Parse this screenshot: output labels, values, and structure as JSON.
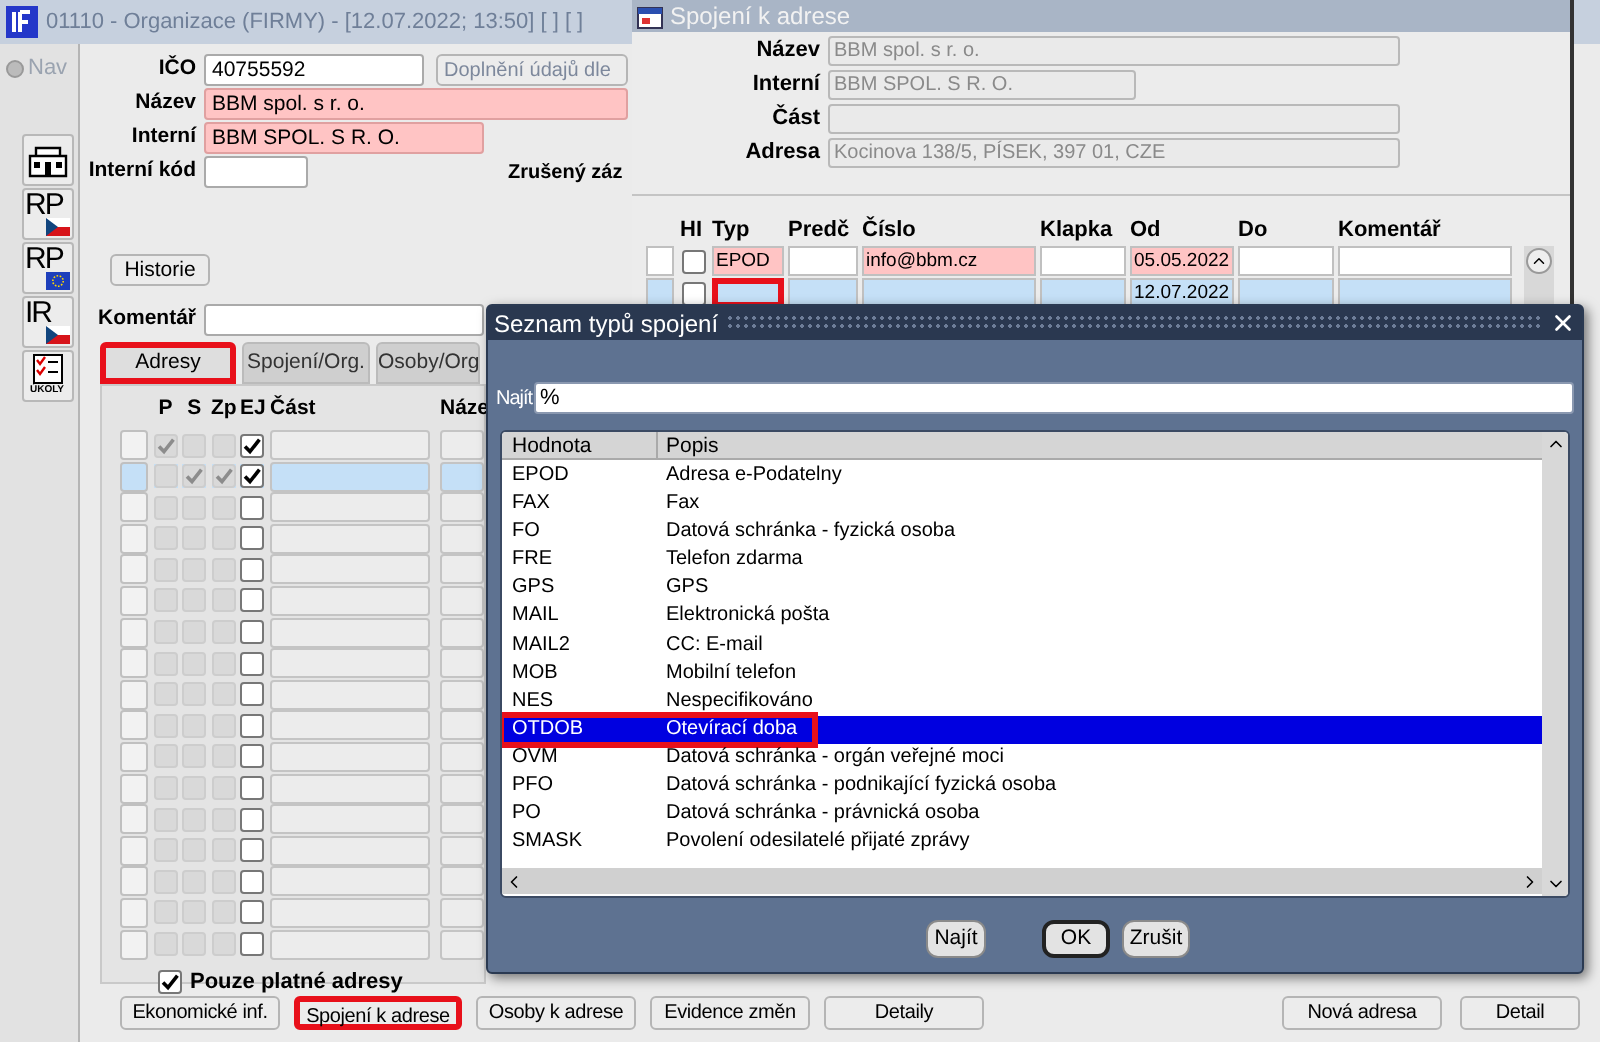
{
  "main_window": {
    "title": "01110 - Organizace (FIRMY) - [12.07.2022; 13:50] [ ] [ ]",
    "nav": {
      "label": "Nav",
      "buttons": [
        {
          "kind": "building"
        },
        {
          "kind": "czflag",
          "label": "RP"
        },
        {
          "kind": "euflag",
          "label": "RP"
        },
        {
          "kind": "czflag",
          "label": "IR"
        },
        {
          "kind": "tasks",
          "label": "ÚKOLY"
        }
      ]
    },
    "fields": [
      {
        "label": "IČO",
        "value": "40755592",
        "required": false
      },
      {
        "label": "Název",
        "value": "BBM spol. s r. o.",
        "required": true
      },
      {
        "label": "Interní",
        "value": "BBM SPOL. S R. O.",
        "required": true
      },
      {
        "label": "Interní kód",
        "required": false
      }
    ],
    "supplement_button": "Doplnění údajů dle",
    "cancelled_label": "Zrušený záz",
    "history_button": "Historie",
    "comment_label": "Komentář",
    "tabs": [
      {
        "label": "Adresy",
        "selected": true,
        "highlighted": true
      },
      {
        "label": "Spojení/Org.",
        "selected": false,
        "highlighted": false
      },
      {
        "label": "Osoby/Org",
        "selected": false,
        "highlighted": false
      }
    ],
    "address_grid": {
      "columns": [
        {
          "label": "P",
          "kind": "check",
          "disabled": true
        },
        {
          "label": "S",
          "kind": "check",
          "disabled": true
        },
        {
          "label": "Zp",
          "kind": "check",
          "disabled": true
        },
        {
          "label": "EJ",
          "kind": "check",
          "disabled": false
        },
        {
          "label": "Část",
          "kind": "text"
        },
        {
          "label": "Náze",
          "kind": "text"
        }
      ],
      "rows": [
        {
          "selected": false,
          "checks": [
            true,
            false,
            false,
            true
          ]
        },
        {
          "selected": true,
          "checks": [
            false,
            true,
            true,
            true
          ]
        },
        {
          "selected": false,
          "checks": [
            false,
            false,
            false,
            false
          ]
        },
        {
          "selected": false,
          "checks": [
            false,
            false,
            false,
            false
          ]
        },
        {
          "selected": false,
          "checks": [
            false,
            false,
            false,
            false
          ]
        },
        {
          "selected": false,
          "checks": [
            false,
            false,
            false,
            false
          ]
        },
        {
          "selected": false,
          "checks": [
            false,
            false,
            false,
            false
          ]
        },
        {
          "selected": false,
          "checks": [
            false,
            false,
            false,
            false
          ]
        },
        {
          "selected": false,
          "checks": [
            false,
            false,
            false,
            false
          ]
        },
        {
          "selected": false,
          "checks": [
            false,
            false,
            false,
            false
          ]
        },
        {
          "selected": false,
          "checks": [
            false,
            false,
            false,
            false
          ]
        },
        {
          "selected": false,
          "checks": [
            false,
            false,
            false,
            false
          ]
        },
        {
          "selected": false,
          "checks": [
            false,
            false,
            false,
            false
          ]
        },
        {
          "selected": false,
          "checks": [
            false,
            false,
            false,
            false
          ]
        },
        {
          "selected": false,
          "checks": [
            false,
            false,
            false,
            false
          ]
        },
        {
          "selected": false,
          "checks": [
            false,
            false,
            false,
            false
          ]
        },
        {
          "selected": false,
          "checks": [
            false,
            false,
            false,
            false
          ]
        }
      ]
    },
    "valid_only": {
      "label": "Pouze platné adresy",
      "checked": true
    },
    "buttons_left": [
      {
        "label": "Ekonomické inf.",
        "highlighted": false
      },
      {
        "label": "Spojení k adrese",
        "highlighted": true
      },
      {
        "label": "Osoby k adrese",
        "highlighted": false
      },
      {
        "label": "Evidence změn",
        "highlighted": false
      },
      {
        "label": "Detaily",
        "highlighted": false
      }
    ],
    "buttons_right": [
      {
        "label": "Nová adresa",
        "highlighted": false
      },
      {
        "label": "Detail",
        "highlighted": false
      }
    ]
  },
  "connection_window": {
    "title": "Spojení k adrese",
    "fields": [
      {
        "label": "Název",
        "value": "BBM spol. s r. o."
      },
      {
        "label": "Interní",
        "value": "BBM SPOL. S R. O."
      },
      {
        "label": "Část"
      },
      {
        "label": "Adresa",
        "value": "Kocinova 138/5, PÍSEK, 397 01, CZE"
      }
    ],
    "grid": {
      "check_column": "HI",
      "columns": [
        {
          "label": "Typ",
          "required": true
        },
        {
          "label": "Predč",
          "required": false
        },
        {
          "label": "Číslo",
          "required": true
        },
        {
          "label": "Klapka",
          "required": false
        },
        {
          "label": "Od",
          "required": true
        },
        {
          "label": "Do",
          "required": false
        },
        {
          "label": "Komentář",
          "required": false
        }
      ],
      "rows": [
        {
          "selected": false,
          "hi": false,
          "cells": [
            "EPOD",
            null,
            "info@bbm.cz",
            null,
            "05.05.2022",
            null,
            null
          ],
          "highlights": [
            false,
            false,
            false,
            false,
            false,
            false,
            false
          ]
        },
        {
          "selected": true,
          "hi": false,
          "cells": [
            null,
            null,
            null,
            null,
            "12.07.2022",
            null,
            null
          ],
          "highlights": [
            true,
            false,
            false,
            false,
            false,
            false,
            false
          ]
        }
      ]
    }
  },
  "lov_dialog": {
    "title": "Seznam typů spojení",
    "find_label": "Najít",
    "find_value": "%",
    "columns": [
      "Hodnota",
      "Popis"
    ],
    "rows": [
      {
        "value": "EPOD",
        "description": "Adresa e-Podatelny",
        "selected": false,
        "highlighted": false
      },
      {
        "value": "FAX",
        "description": "Fax",
        "selected": false,
        "highlighted": false
      },
      {
        "value": "FO",
        "description": "Datová schránka - fyzická osoba",
        "selected": false,
        "highlighted": false
      },
      {
        "value": "FRE",
        "description": "Telefon zdarma",
        "selected": false,
        "highlighted": false
      },
      {
        "value": "GPS",
        "description": "GPS",
        "selected": false,
        "highlighted": false
      },
      {
        "value": "MAIL",
        "description": "Elektronická pošta",
        "selected": false,
        "highlighted": false
      },
      {
        "value": "MAIL2",
        "description": "CC: E-mail",
        "selected": false,
        "highlighted": false
      },
      {
        "value": "MOB",
        "description": "Mobilní telefon",
        "selected": false,
        "highlighted": false
      },
      {
        "value": "NES",
        "description": "Nespecifikováno",
        "selected": false,
        "highlighted": false
      },
      {
        "value": "OTDOB",
        "description": "Otevírací doba",
        "selected": true,
        "highlighted": true
      },
      {
        "value": "OVM",
        "description": "Datová schránka - orgán veřejné moci",
        "selected": false,
        "highlighted": false
      },
      {
        "value": "PFO",
        "description": "Datová schránka - podnikající fyzická osoba",
        "selected": false,
        "highlighted": false
      },
      {
        "value": "PO",
        "description": "Datová schránka - právnická osoba",
        "selected": false,
        "highlighted": false
      },
      {
        "value": "SMASK",
        "description": "Povolení odesilatelé přijaté zprávy",
        "selected": false,
        "highlighted": false
      }
    ],
    "buttons": [
      {
        "label": "Najít",
        "default": false
      },
      {
        "label": "OK",
        "default": true
      },
      {
        "label": "Zrušit",
        "default": false
      }
    ]
  }
}
